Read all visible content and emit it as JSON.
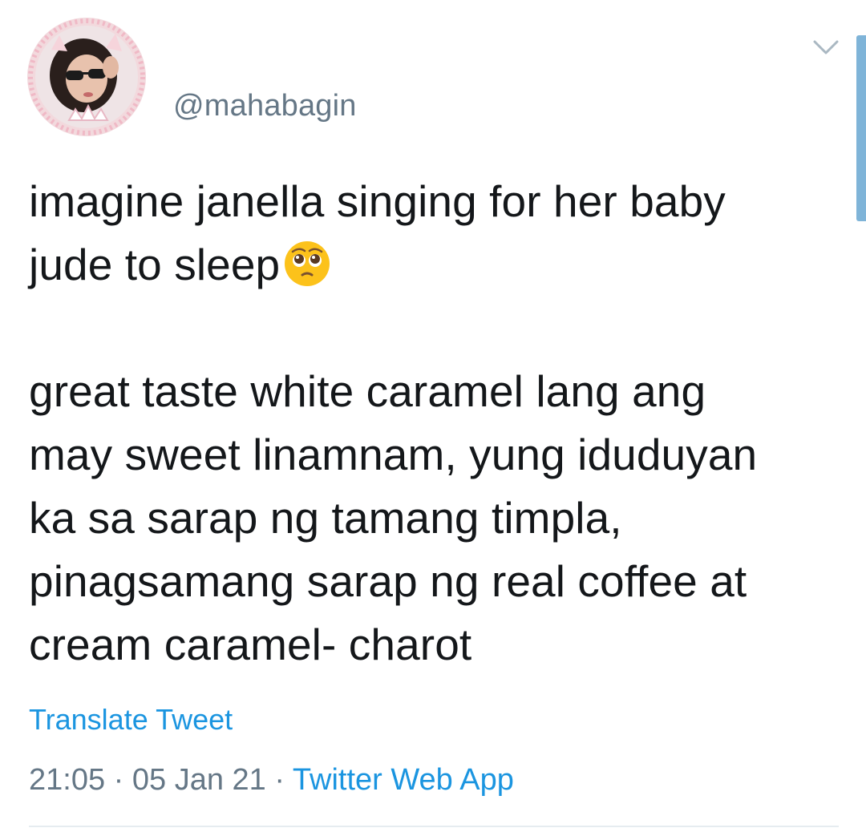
{
  "tweet": {
    "handle": "@mahabagin",
    "paragraph1": "imagine janella singing for her baby\njude to sleep",
    "emoji": "pleading-face-emoji",
    "paragraph2": "great taste white caramel lang ang\nmay sweet linamnam, yung iduduyan\nka sa sarap ng tamang timpla,\npinagsamang sarap ng real coffee at\ncream caramel- charot",
    "translate_label": "Translate Tweet",
    "time": "21:05",
    "date": "05 Jan 21",
    "separator": "·",
    "source": "Twitter Web App"
  },
  "icons": {
    "more": "chevron-down-icon",
    "avatar": "profile-avatar"
  },
  "colors": {
    "link": "#1b95e0",
    "secondary_text": "#657786",
    "primary_text": "#14171a",
    "divider": "#e6ecf0",
    "accent_bar": "#7fb4d8"
  }
}
